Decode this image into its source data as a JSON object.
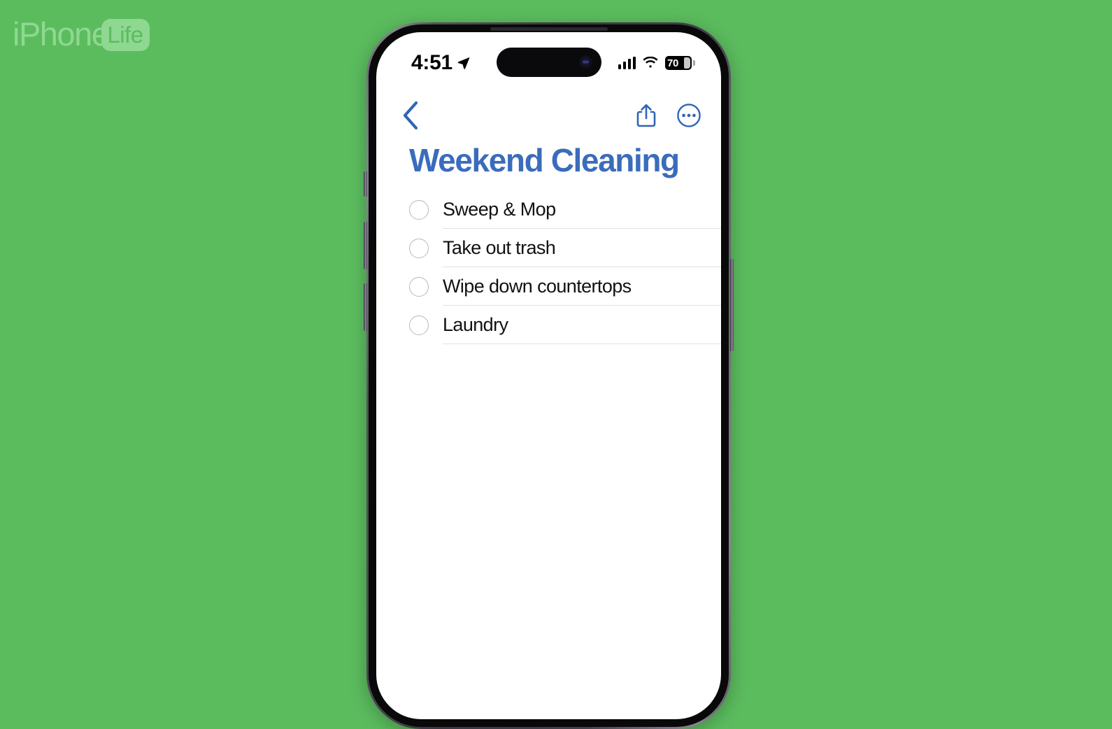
{
  "background_color": "#5bbc5e",
  "watermark": {
    "name": "iPhone Life",
    "part1": "iPhone",
    "part2": "Life"
  },
  "phone": {
    "frame_color": "#3b3742",
    "side_buttons": [
      {
        "name": "silent-switch",
        "side": "left"
      },
      {
        "name": "volume-up-button",
        "side": "left"
      },
      {
        "name": "volume-down-button",
        "side": "left"
      },
      {
        "name": "power-button",
        "side": "right"
      }
    ]
  },
  "status_bar": {
    "time": "4:51",
    "location_icon": "location-arrow-icon",
    "signal_icon": "cellular-signal-icon",
    "signal_bars": 4,
    "wifi_icon": "wifi-icon",
    "battery_level": "70",
    "battery_icon": "battery-icon"
  },
  "nav_bar": {
    "back_icon": "chevron-left-icon",
    "back_label": "",
    "share_icon": "share-icon",
    "more_icon": "more-circle-icon",
    "accent_color": "#2f66b5"
  },
  "list": {
    "title": "Weekend Cleaning",
    "title_color": "#3b6cbc",
    "items": [
      {
        "label": "Sweep & Mop",
        "completed": false
      },
      {
        "label": "Take out trash",
        "completed": false
      },
      {
        "label": "Wipe down countertops",
        "completed": false
      },
      {
        "label": "Laundry",
        "completed": false
      }
    ]
  }
}
